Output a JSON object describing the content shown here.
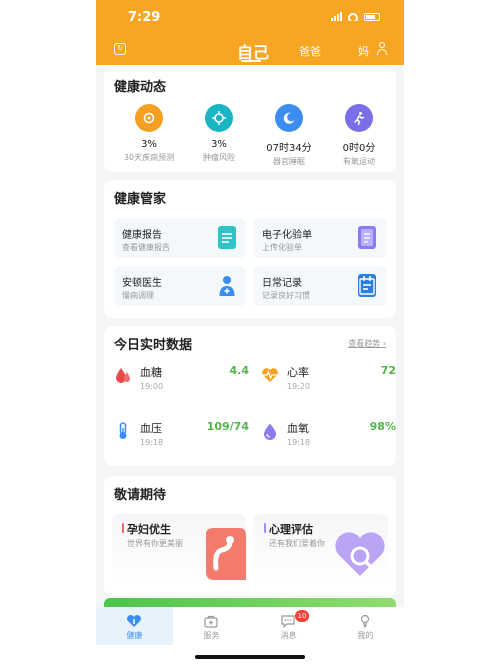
{
  "status_bar": {
    "time": "7:29"
  },
  "header": {
    "tabs": {
      "self": "自己",
      "dad": "爸爸",
      "mom": "妈"
    }
  },
  "health_dynamics": {
    "title": "健康动态",
    "stats": [
      {
        "value": "3%",
        "label": "30天疾病预测",
        "color": "#f5a020",
        "icon": "shield-icon"
      },
      {
        "value": "3%",
        "label": "肿瘤风险",
        "color": "#19b5c4",
        "icon": "virus-icon"
      },
      {
        "value": "07时34分",
        "label": "器官睡眠",
        "color": "#3b8ef0",
        "icon": "moon-icon"
      },
      {
        "value": "0时0分",
        "label": "有氧运动",
        "color": "#7b6fe8",
        "icon": "runner-icon"
      }
    ]
  },
  "health_manager": {
    "title": "健康管家",
    "tiles": [
      {
        "title": "健康报告",
        "sub": "查看健康报告",
        "color": "#2ec4c6",
        "icon": "report-icon"
      },
      {
        "title": "电子化验单",
        "sub": "上传化验单",
        "color": "#8a7cf0",
        "icon": "lab-sheet-icon"
      },
      {
        "title": "安顿医生",
        "sub": "慢病调理",
        "color": "#3b8ef0",
        "icon": "doctor-icon"
      },
      {
        "title": "日常记录",
        "sub": "记录良好习惯",
        "color": "#2a7fe0",
        "icon": "calendar-icon"
      }
    ]
  },
  "realtime": {
    "title": "今日实时数据",
    "trend_link": "查看趋势",
    "items": [
      {
        "name": "血糖",
        "time": "19:00",
        "value": "4.4",
        "color": "#e84a4a",
        "icon": "blood-drop-icon"
      },
      {
        "name": "心率",
        "time": "19:20",
        "value": "72",
        "color": "#f5a020",
        "icon": "heart-rate-icon"
      },
      {
        "name": "血压",
        "time": "19:18",
        "value": "109/74",
        "color": "#3b8ef0",
        "icon": "thermometer-icon"
      },
      {
        "name": "血氧",
        "time": "19:18",
        "value": "98%",
        "color": "#8a7cf0",
        "icon": "oxygen-drop-icon"
      }
    ]
  },
  "coming_soon": {
    "title": "敬请期待",
    "cards": [
      {
        "title": "孕妇优生",
        "sub": "世界有你更美丽",
        "accent": "#f06464",
        "icon": "pregnancy-icon"
      },
      {
        "title": "心理评估",
        "sub": "还有我们爱着你",
        "accent": "#a48cf0",
        "icon": "heart-search-icon"
      }
    ]
  },
  "tabbar": {
    "items": [
      {
        "label": "健康",
        "active": true,
        "icon": "health-home-icon"
      },
      {
        "label": "服务",
        "active": false,
        "icon": "service-bag-icon"
      },
      {
        "label": "消息",
        "active": false,
        "icon": "message-icon",
        "badge": "10"
      },
      {
        "label": "我的",
        "active": false,
        "icon": "profile-icon"
      }
    ]
  },
  "colors": {
    "brand": "#f6a623",
    "value_green": "#52b548",
    "active_blue": "#3b8ef0"
  }
}
